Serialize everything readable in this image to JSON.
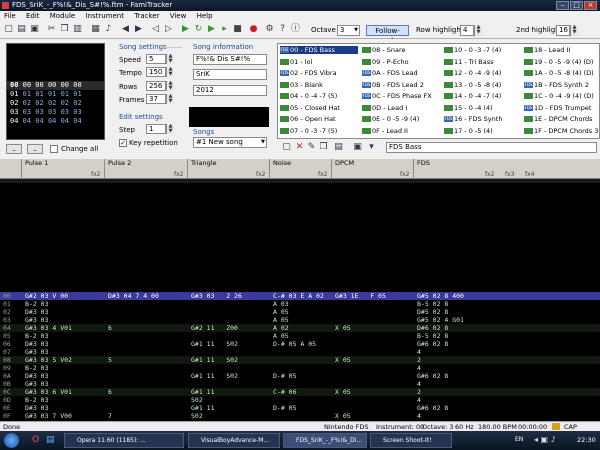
{
  "window": {
    "title": "FDS_SriK_-_F%!&_Dis_S#!%.ftm - FamiTracker"
  },
  "menu": [
    "File",
    "Edit",
    "Module",
    "Instrument",
    "Tracker",
    "View",
    "Help"
  ],
  "toolbar": {
    "octave_label": "Octave",
    "octave_value": "3",
    "follow_mode": "Follow-mode",
    "row_highlight_label": "Row highlight",
    "row_highlight_value": "4",
    "second_highlight_label": "2nd highlight",
    "second_highlight_value": "16"
  },
  "frames": {
    "rows": [
      {
        "num": "00",
        "values": "00 00 00 00 00"
      },
      {
        "num": "01",
        "values": "01 01 01 01 01"
      },
      {
        "num": "02",
        "values": "02 02 02 02 02"
      },
      {
        "num": "03",
        "values": "03 03 03 03 03"
      },
      {
        "num": "04",
        "values": "04 04 04 04 04"
      }
    ],
    "change_all_label": "Change all"
  },
  "song_settings": {
    "title": "Song settings",
    "speed_label": "Speed",
    "speed": "5",
    "tempo_label": "Tempo",
    "tempo": "150",
    "rows_label": "Rows",
    "rows": "256",
    "frames_label": "Frames",
    "frames": "37"
  },
  "edit_settings": {
    "title": "Edit settings",
    "step_label": "Step",
    "step": "1",
    "key_repetition": "Key repetition"
  },
  "song_info": {
    "title": "Song information",
    "name": "F%!& Dis S#!%",
    "artist": "SriK",
    "copyright": "2012"
  },
  "songs": {
    "title": "Songs",
    "selected": "#1 New song"
  },
  "instruments": {
    "items": [
      {
        "id": "00",
        "name": "FDS Bass",
        "fds": true,
        "sel": true
      },
      {
        "id": "01",
        "name": "lol",
        "fds": false
      },
      {
        "id": "02",
        "name": "FDS Vibra",
        "fds": true
      },
      {
        "id": "03",
        "name": "Blank",
        "fds": false
      },
      {
        "id": "04",
        "name": "0 -4 -7 (5)",
        "fds": false
      },
      {
        "id": "05",
        "name": "Closed Hat",
        "fds": false
      },
      {
        "id": "06",
        "name": "Open Hat",
        "fds": false
      },
      {
        "id": "07",
        "name": "0 -3 -7 (5)",
        "fds": false
      },
      {
        "id": "08",
        "name": "Snare",
        "fds": false
      },
      {
        "id": "09",
        "name": "P-Echo",
        "fds": false
      },
      {
        "id": "0A",
        "name": "FDS Lead",
        "fds": true
      },
      {
        "id": "0B",
        "name": "FDS Lead 2",
        "fds": true
      },
      {
        "id": "0C",
        "name": "FDS Phase FX",
        "fds": true
      },
      {
        "id": "0D",
        "name": "Lead I",
        "fds": false
      },
      {
        "id": "0E",
        "name": "0 -5 -9 (4)",
        "fds": false
      },
      {
        "id": "0F",
        "name": "Lead II",
        "fds": false
      },
      {
        "id": "10",
        "name": "0 -3 -7 (4)",
        "fds": false
      },
      {
        "id": "11",
        "name": "Tri Bass",
        "fds": false
      },
      {
        "id": "12",
        "name": "0 -4 -9 (4)",
        "fds": false
      },
      {
        "id": "13",
        "name": "0 -5 -8 (4)",
        "fds": false
      },
      {
        "id": "14",
        "name": "0 -4 -7 (4)",
        "fds": false
      },
      {
        "id": "15",
        "name": "0 -4 (4)",
        "fds": false
      },
      {
        "id": "16",
        "name": "FDS Synth",
        "fds": true
      },
      {
        "id": "17",
        "name": "0 -5 (4)",
        "fds": false
      },
      {
        "id": "18",
        "name": "Lead II",
        "fds": false
      },
      {
        "id": "19",
        "name": "0 -5 -9 (4) (D)",
        "fds": false
      },
      {
        "id": "1A",
        "name": "0 -5 -8 (4) (D)",
        "fds": false
      },
      {
        "id": "1B",
        "name": "FDS Synth 2",
        "fds": true
      },
      {
        "id": "1C",
        "name": "0 -4 -9 (4) (D)",
        "fds": false
      },
      {
        "id": "1D",
        "name": "FDS Trumpet",
        "fds": true
      },
      {
        "id": "1E",
        "name": "DPCM Chords",
        "fds": false
      },
      {
        "id": "1F",
        "name": "DPCM Chords 3",
        "fds": false
      }
    ],
    "name_field": "FDS Bass"
  },
  "channels": [
    {
      "name": "Pulse 1",
      "fx": [
        "fx2"
      ]
    },
    {
      "name": "Pulse 2",
      "fx": [
        "fx2"
      ]
    },
    {
      "name": "Triangle",
      "fx": [
        "fx2"
      ]
    },
    {
      "name": "Noise",
      "fx": [
        "fx2"
      ]
    },
    {
      "name": "DPCM",
      "fx": [
        "fx2"
      ]
    },
    {
      "name": "FDS",
      "fx": [
        "fx2",
        "fx3",
        "fx4"
      ]
    }
  ],
  "pattern_rows": [
    {
      "n": "00",
      "p1": "G#2 03 V 00",
      "p2": "D#3 04 7 4 00",
      "tri": "G#3 03   2 26",
      "noi": "C-# 03 E A 02",
      "dpcm": "G#3 1E   F 05",
      "fds": "G#5 02 8 400",
      "cur": true
    },
    {
      "n": "01",
      "p1": "B-2 03",
      "p2": "",
      "tri": "",
      "noi": "A 03",
      "dpcm": "",
      "fds": "B-5 02 8"
    },
    {
      "n": "02",
      "p1": "D#3 03",
      "p2": "",
      "tri": "",
      "noi": "A 05",
      "dpcm": "",
      "fds": "D#5 02 8"
    },
    {
      "n": "03",
      "p1": "G#3 03",
      "p2": "",
      "tri": "",
      "noi": "A 05",
      "dpcm": "",
      "fds": "G#5 02 4 G01"
    },
    {
      "n": "04",
      "p1": "G#3 03 4 V01",
      "p2": "6",
      "tri": "G#2 11   Z00",
      "noi": "A 02",
      "dpcm": "X 05",
      "fds": "D#6 02 8"
    },
    {
      "n": "05",
      "p1": "B-2 03",
      "p2": "",
      "tri": "",
      "noi": "A 05",
      "dpcm": "",
      "fds": "B-5 02 8"
    },
    {
      "n": "06",
      "p1": "D#3 03",
      "p2": "",
      "tri": "G#1 11   S02",
      "noi": "D-# 05 A 05",
      "dpcm": "",
      "fds": "G#6 02 8"
    },
    {
      "n": "07",
      "p1": "G#3 03",
      "p2": "",
      "tri": "",
      "noi": "",
      "dpcm": "",
      "fds": "4"
    },
    {
      "n": "08",
      "p1": "G#3 03 5 V02",
      "p2": "5",
      "tri": "G#1 11   S02",
      "noi": "",
      "dpcm": "X 05",
      "fds": "2"
    },
    {
      "n": "09",
      "p1": "B-2 03",
      "p2": "",
      "tri": "",
      "noi": "",
      "dpcm": "",
      "fds": "4"
    },
    {
      "n": "0A",
      "p1": "D#3 03",
      "p2": "",
      "tri": "G#1 11   S02",
      "noi": "D-# 05",
      "dpcm": "",
      "fds": "G#6 02 8"
    },
    {
      "n": "0B",
      "p1": "G#3 03",
      "p2": "",
      "tri": "",
      "noi": "",
      "dpcm": "",
      "fds": "4"
    },
    {
      "n": "0C",
      "p1": "G#3 03 6 V01",
      "p2": "6",
      "tri": "G#1 11",
      "noi": "C-# 06",
      "dpcm": "X 05",
      "fds": "2"
    },
    {
      "n": "0D",
      "p1": "B-2 03",
      "p2": "",
      "tri": "S02",
      "noi": "",
      "dpcm": "",
      "fds": "4"
    },
    {
      "n": "0E",
      "p1": "D#3 03",
      "p2": "",
      "tri": "G#1 11",
      "noi": "D-# 05",
      "dpcm": "",
      "fds": "G#6 02 8"
    },
    {
      "n": "0F",
      "p1": "G#3 03 7 V00",
      "p2": "7",
      "tri": "S02",
      "noi": "",
      "dpcm": "X 05",
      "fds": "4"
    }
  ],
  "status": {
    "left": "Done",
    "chip": "Nintendo FDS",
    "instrument": "Instrument: 00",
    "octave": "Octave: 3",
    "rate": "60 Hz",
    "bpm": "180.00 BPM",
    "pos": "00:00:00",
    "cap": "CAP"
  },
  "taskbar": {
    "tasks": [
      "Opera 11.60 (1185): ...",
      "VisualBoyAdvance-M...",
      "FDS_SriK_-_F%!&_Di...",
      "Screen Shoot-It!"
    ],
    "lang": "EN",
    "time": "22:30"
  },
  "colors": {
    "accent": "#1a3a8a",
    "title_bar": "#1a2a44",
    "pattern_bg": "#000000"
  }
}
